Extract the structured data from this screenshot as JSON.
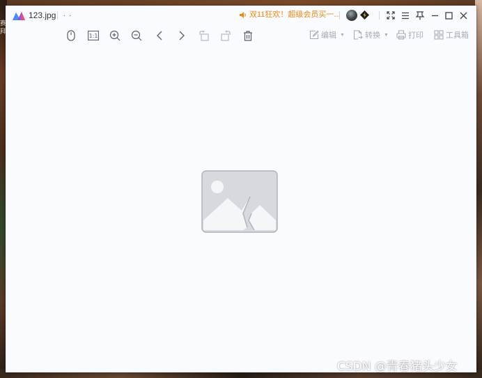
{
  "titlebar": {
    "filename": "123.jpg",
    "tab_dots": ". .",
    "promo_text": "双11狂欢！超级会员买一...",
    "buttons": [
      "fullscreen",
      "menu",
      "pin",
      "minimize",
      "maximize",
      "close"
    ]
  },
  "toolbar": {
    "left_icons": [
      "mouse-icon",
      "actual-size-icon",
      "zoom-in-icon",
      "zoom-out-icon",
      "previous-icon",
      "next-icon",
      "rotate-left-icon",
      "rotate-right-icon",
      "delete-icon"
    ],
    "actual_size_label": "1:1",
    "edit_label": "编辑",
    "convert_label": "转换",
    "print_label": "打印",
    "toolbox_label": "工具箱"
  },
  "background": {
    "left_text": "赛 拜"
  },
  "watermark": {
    "text": "CSDN @青春猪头少女"
  },
  "colors": {
    "window_bg": "#fafbfe",
    "promo": "#f08a10",
    "icon": "#5a5f68",
    "muted": "#a7abb3"
  }
}
